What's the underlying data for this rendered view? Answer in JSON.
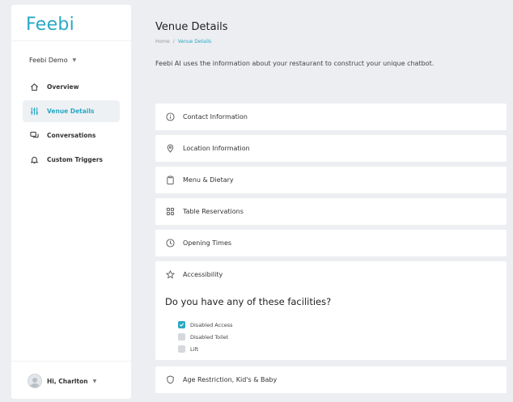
{
  "app": {
    "logo": "Feebi",
    "org": "Feebi Demo",
    "accent": "#2aa8c4"
  },
  "sidebar": {
    "items": [
      {
        "label": "Overview",
        "icon": "home-icon",
        "active": false
      },
      {
        "label": "Venue Details",
        "icon": "sliders-icon",
        "active": true
      },
      {
        "label": "Conversations",
        "icon": "chat-icon",
        "active": false
      },
      {
        "label": "Custom Triggers",
        "icon": "bell-icon",
        "active": false
      }
    ],
    "user": "Hi, Charlton"
  },
  "main": {
    "title": "Venue Details",
    "breadcrumb": {
      "home": "Home",
      "sep": "/",
      "current": "Venue Details"
    },
    "intro": "Feebi AI uses the information about your restaurant to construct your unique chatbot.",
    "sections": [
      {
        "label": "Contact Information",
        "icon": "info-icon"
      },
      {
        "label": "Location Information",
        "icon": "pin-icon"
      },
      {
        "label": "Menu & Dietary",
        "icon": "clipboard-icon"
      },
      {
        "label": "Table Reservations",
        "icon": "grid-icon"
      },
      {
        "label": "Opening Times",
        "icon": "clock-icon"
      },
      {
        "label": "Accessibility",
        "icon": "star-icon"
      },
      {
        "label": "Age Restriction, Kid's & Baby",
        "icon": "shield-icon"
      }
    ],
    "accessibility": {
      "question": "Do you have any of these facilities?",
      "options": [
        {
          "label": "Disabled Access",
          "checked": true
        },
        {
          "label": "Disabled Toilet",
          "checked": false
        },
        {
          "label": "Lift",
          "checked": false
        }
      ]
    }
  }
}
